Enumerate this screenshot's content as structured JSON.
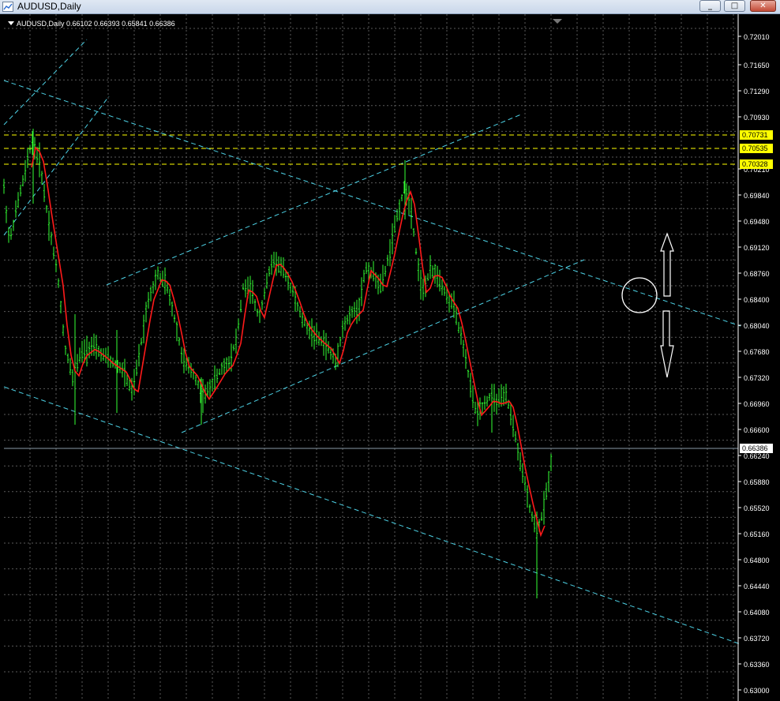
{
  "window": {
    "title": "AUDUSD,Daily",
    "minimize_glyph": "_",
    "restore_glyph": "□",
    "close_glyph": "✕"
  },
  "chart": {
    "symbol_info": "AUDUSD,Daily  0.66102 0.66393 0.65841 0.66386",
    "current_price_label": "0.66386",
    "price_ticks": [
      "0.72010",
      "0.71650",
      "0.71290",
      "0.70930",
      "0.70210",
      "0.69840",
      "0.69480",
      "0.69120",
      "0.68760",
      "0.68400",
      "0.68040",
      "0.67680",
      "0.67320",
      "0.66960",
      "0.66600",
      "0.66240",
      "0.65880",
      "0.65520",
      "0.65160",
      "0.64800",
      "0.64440",
      "0.64080",
      "0.63720",
      "0.63360",
      "0.63000"
    ],
    "level_labels": [
      "0.70731",
      "0.70535",
      "0.70328"
    ],
    "colors": {
      "background": "#000000",
      "grid": "#5a5a5a",
      "candles": "#33ff33",
      "moving_average": "#ff1a1a",
      "trendline": "#4dd2e6",
      "level_line": "#ffff00",
      "axis_text": "#ffffff"
    }
  }
}
